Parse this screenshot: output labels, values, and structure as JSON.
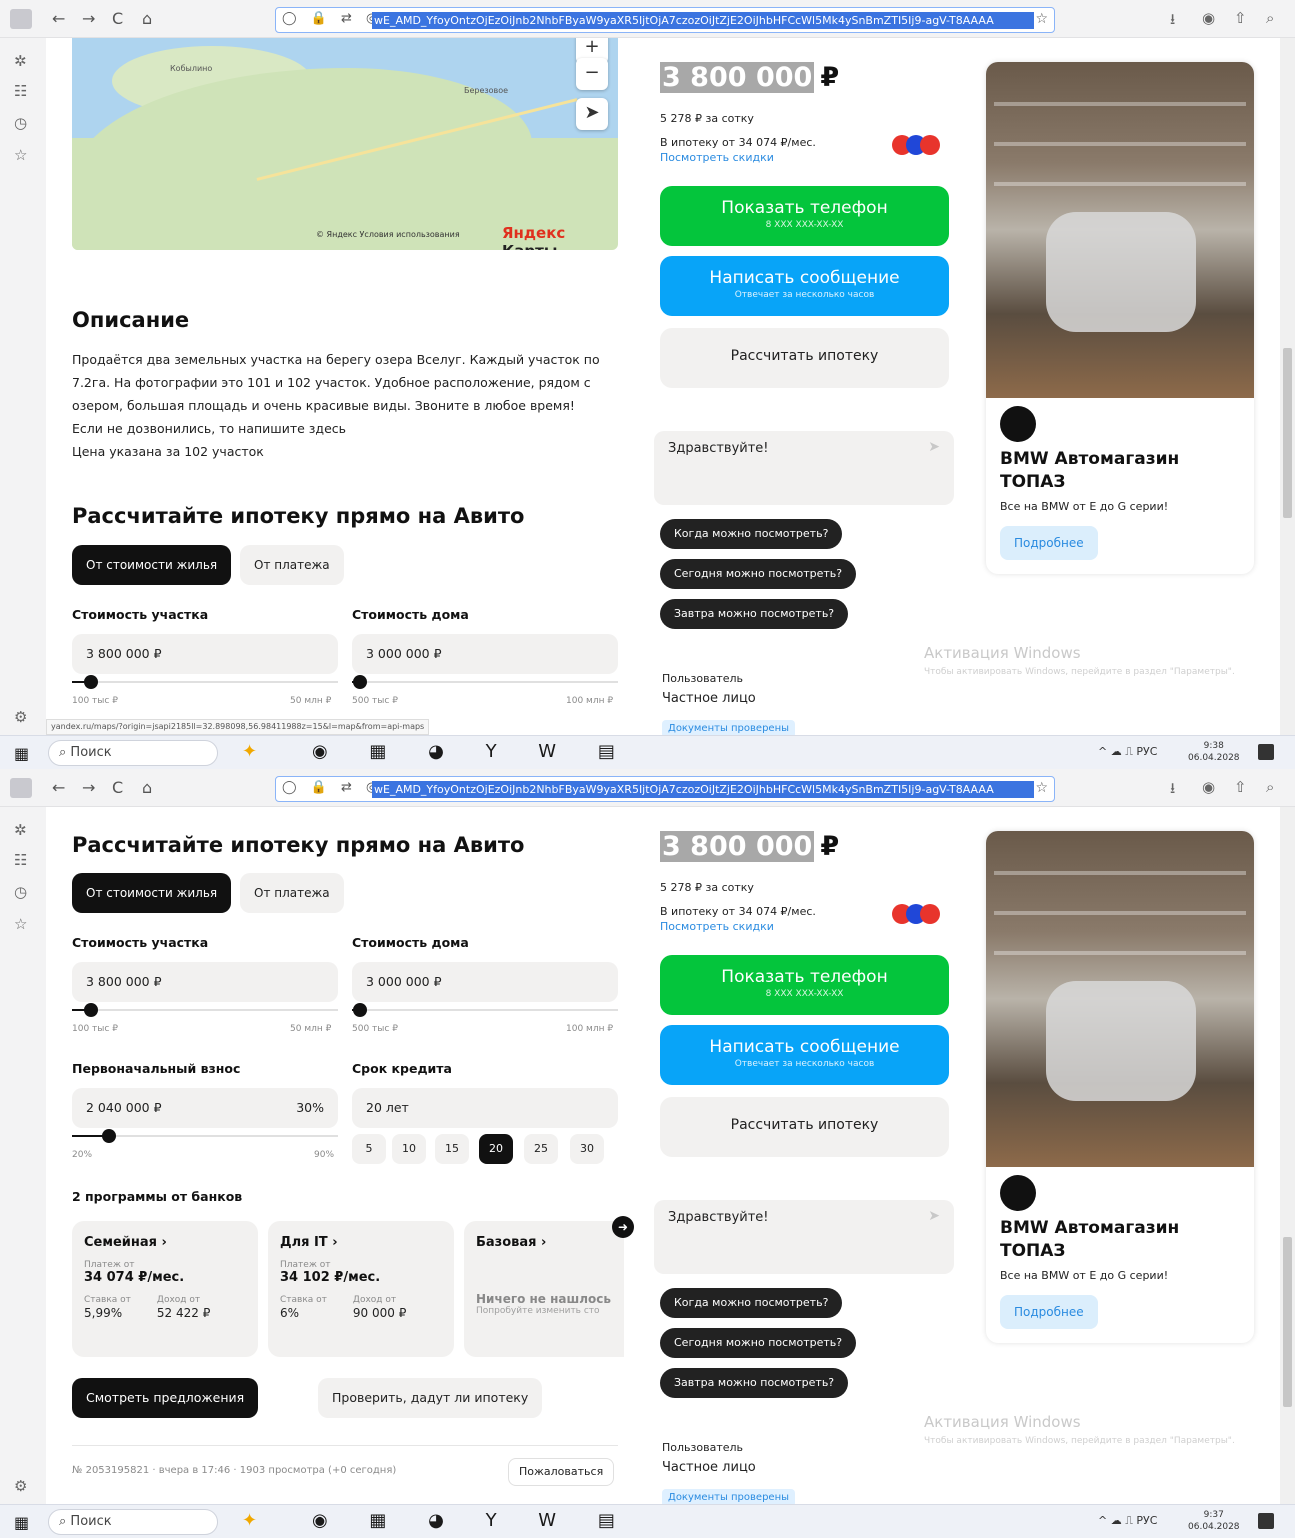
{
  "browser": {
    "url": "wE_AMD_YfoyOntzOjEzOiJnb2NhbFByaW9yaXR5IjtOjA7czozOiJtZjE2OiJhbHFCcWl5Mk4ySnBmZTI5Ij9-agV-T8AAAA",
    "nav": {
      "back": "←",
      "forward": "→",
      "reload": "C",
      "home": "⌂"
    },
    "url_icons": "◯ 🔒 ⇄ ◎",
    "star": "☆",
    "right_icons": [
      "⭳",
      "◉",
      "⇧",
      "⌕"
    ],
    "sidebar_icons": [
      "✲",
      "☷",
      "◷",
      "☆"
    ],
    "settings_icon": "⚙"
  },
  "taskbar": {
    "search": "Поиск",
    "tray": "^ ☁ ⎍ РУС",
    "shot1_time": "9:38",
    "shot1_date": "06.04.2028",
    "shot2_time": "9:37",
    "shot2_date": "06.04.2028",
    "apps": "◉ ▦ ◕ Y W ▤"
  },
  "map": {
    "label1": "Кобылино",
    "label2": "Березовое",
    "zoom_in": "+",
    "zoom_out": "−",
    "locate": "➤",
    "copyright": "© Яндекс Условия использования",
    "brand": "Яндекс",
    "brand2": " Карты"
  },
  "status_url": "yandex.ru/maps/?origin=jsapi2185ll=32.898098,56.98411988z=15&l=map&from=api-maps",
  "description": {
    "title": "Описание",
    "lines": [
      "Продаётся два земельных участка на берегу озера Вселуг. Каждый участок по",
      "7.2га. На фотографии это 101 и 102 участок. Удобное расположение, рядом с",
      "озером, большая площадь и очень красивые виды. Звоните в любое время!",
      "Если не дозвонились, то напишите здесь",
      "Цена указана за 102 участок"
    ]
  },
  "mortgage": {
    "title": "Рассчитайте ипотеку прямо на Авито",
    "tab_on": "От стоимости жилья",
    "tab_off": "От платежа",
    "plot_label": "Стоимость участка",
    "plot_value": "3 800 000 ₽",
    "plot_min": "100 тыс ₽",
    "plot_max": "50 млн ₽",
    "plot_level": 0.07,
    "house_label": "Стоимость дома",
    "house_value": "3 000 000 ₽",
    "house_min": "500 тыс ₽",
    "house_max": "100 млн ₽",
    "house_level": 0.03,
    "down_label": "Первоначальный взнос",
    "down_value": "2 040 000 ₽",
    "down_pct": "30%",
    "down_min": "20%",
    "down_max": "90%",
    "down_level": 0.14,
    "term_label": "Срок кредита",
    "term_value": "20 лет",
    "term_options": [
      "5",
      "10",
      "15",
      "20",
      "25",
      "30"
    ],
    "term_selected": "20",
    "programs_title": "2 программы от банков",
    "programs": [
      {
        "name": "Семейная ›",
        "pay_label": "Платеж от",
        "pay": "34 074 ₽/мес.",
        "rate_label": "Ставка от",
        "rate": "5,99%",
        "income_label": "Доход от",
        "income": "52 422 ₽"
      },
      {
        "name": "Для IT ›",
        "pay_label": "Платеж от",
        "pay": "34 102 ₽/мес.",
        "rate_label": "Ставка от",
        "rate": "6%",
        "income_label": "Доход от",
        "income": "90 000 ₽"
      },
      {
        "name": "Базовая ›",
        "not_found": "Ничего не нашлось",
        "not_found_sub": "Попробуйте изменить сто"
      }
    ],
    "next_arrow": "➜",
    "offers_button": "Смотреть предложения",
    "check_button": "Проверить, дадут ли ипотеку"
  },
  "footer": {
    "info": "№ 2053195821 · вчера в 17:46 · 1903 просмотра (+0 сегодня)",
    "complain": "Пожаловаться"
  },
  "listing": {
    "price": "3 800 000",
    "currency": "₽",
    "per_sotka": "5 278 ₽ за сотку",
    "mortgage_from": "В ипотеку от 34 074 ₽/мес.",
    "discounts": "Посмотреть скидки",
    "show_phone": "Показать телефон",
    "phone_mask": "8 XXX XXX-XX-XX",
    "write": "Написать сообщение",
    "write_sub": "Отвечает за несколько часов",
    "calc": "Рассчитать ипотеку",
    "chat_placeholder": "Здравствуйте!",
    "send": "➤",
    "quick": [
      "Когда можно посмотреть?",
      "Сегодня можно посмотреть?",
      "Завтра можно посмотреть?"
    ],
    "seller_role": "Пользователь",
    "seller_type": "Частное лицо",
    "docs": "Документы проверены"
  },
  "ad": {
    "title": "BMW Автомагазин ТОПАЗ",
    "desc": "Все на BMW от E до G серии!",
    "button": "Подробнее"
  },
  "windows": {
    "activate": "Активация Windows",
    "activate_sub": "Чтобы активировать Windows, перейдите в раздел \"Параметры\"."
  }
}
